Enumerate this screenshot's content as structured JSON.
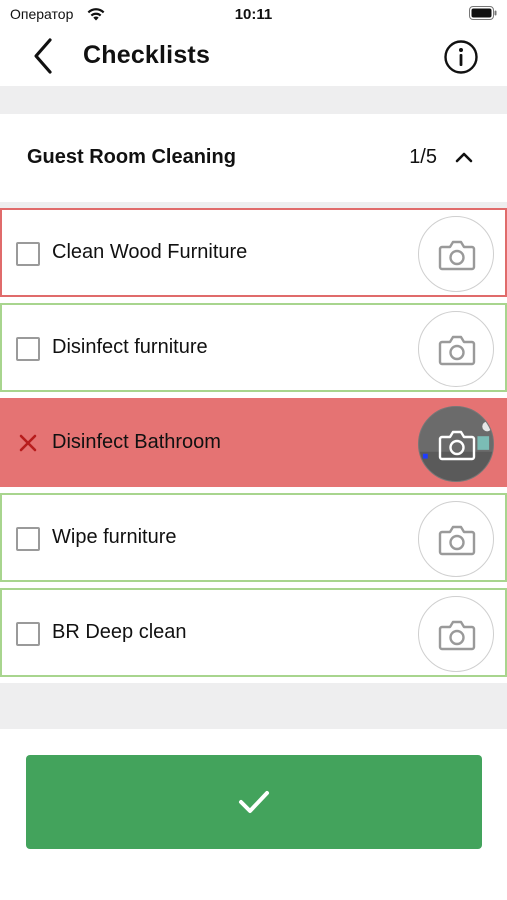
{
  "status_bar": {
    "carrier": "Оператор",
    "time": "10:11"
  },
  "nav": {
    "title": "Checklists",
    "back_icon": "chevron-left-icon",
    "info_icon": "info-circle-icon"
  },
  "section": {
    "title": "Guest Room Cleaning",
    "count": "1/5",
    "expanded": true
  },
  "items": [
    {
      "label": "Clean Wood Furniture",
      "state": "error",
      "has_photo": false
    },
    {
      "label": "Disinfect furniture",
      "state": "pending",
      "has_photo": false
    },
    {
      "label": "Disinfect Bathroom",
      "state": "failed",
      "has_photo": true
    },
    {
      "label": "Wipe furniture",
      "state": "pending",
      "has_photo": false
    },
    {
      "label": "BR Deep clean",
      "state": "pending",
      "has_photo": false
    }
  ],
  "colors": {
    "accent_green": "#43a35c",
    "ok_border": "#a8d58e",
    "error_border": "#e06b6b",
    "failed_background": "#e57373"
  },
  "confirm": {
    "icon": "check-icon"
  }
}
